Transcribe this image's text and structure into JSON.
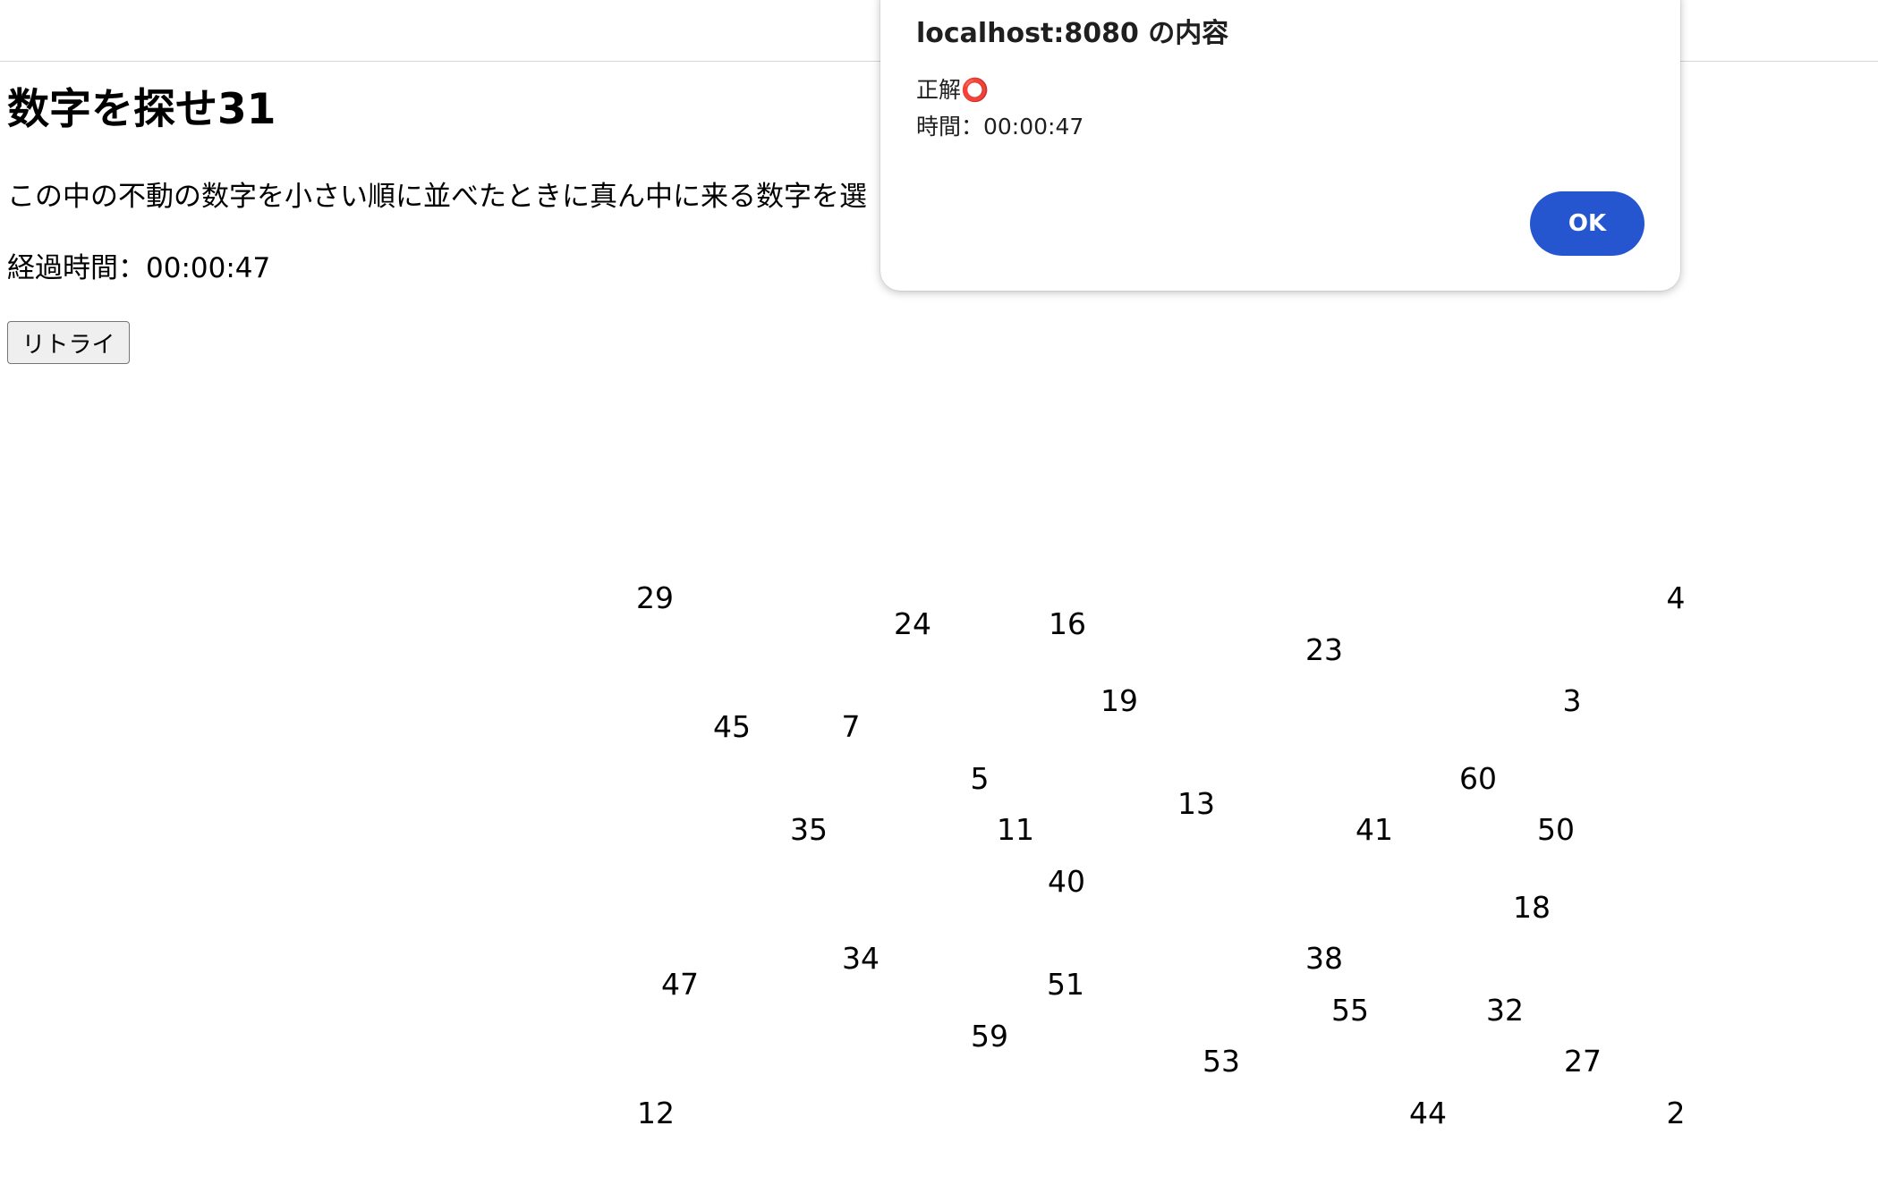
{
  "page": {
    "title": "数字を探せ31",
    "description": "この中の不動の数字を小さい順に並べたときに真ん中に来る数字を選",
    "elapsed": "経過時間：00:00:47",
    "retry_label": "リトライ"
  },
  "numbers": [
    "29",
    "4",
    "24",
    "16",
    "23",
    "19",
    "3",
    "45",
    "7",
    "5",
    "60",
    "13",
    "35",
    "11",
    "41",
    "50",
    "40",
    "18",
    "34",
    "38",
    "47",
    "51",
    "55",
    "32",
    "59",
    "53",
    "27",
    "12",
    "44",
    "2"
  ],
  "dialog": {
    "title": "localhost:8080 の内容",
    "message_line1": "正解⭕",
    "message_line2": "時間：00:00:47",
    "ok_label": "OK",
    "ok_color": "#2556cf"
  }
}
